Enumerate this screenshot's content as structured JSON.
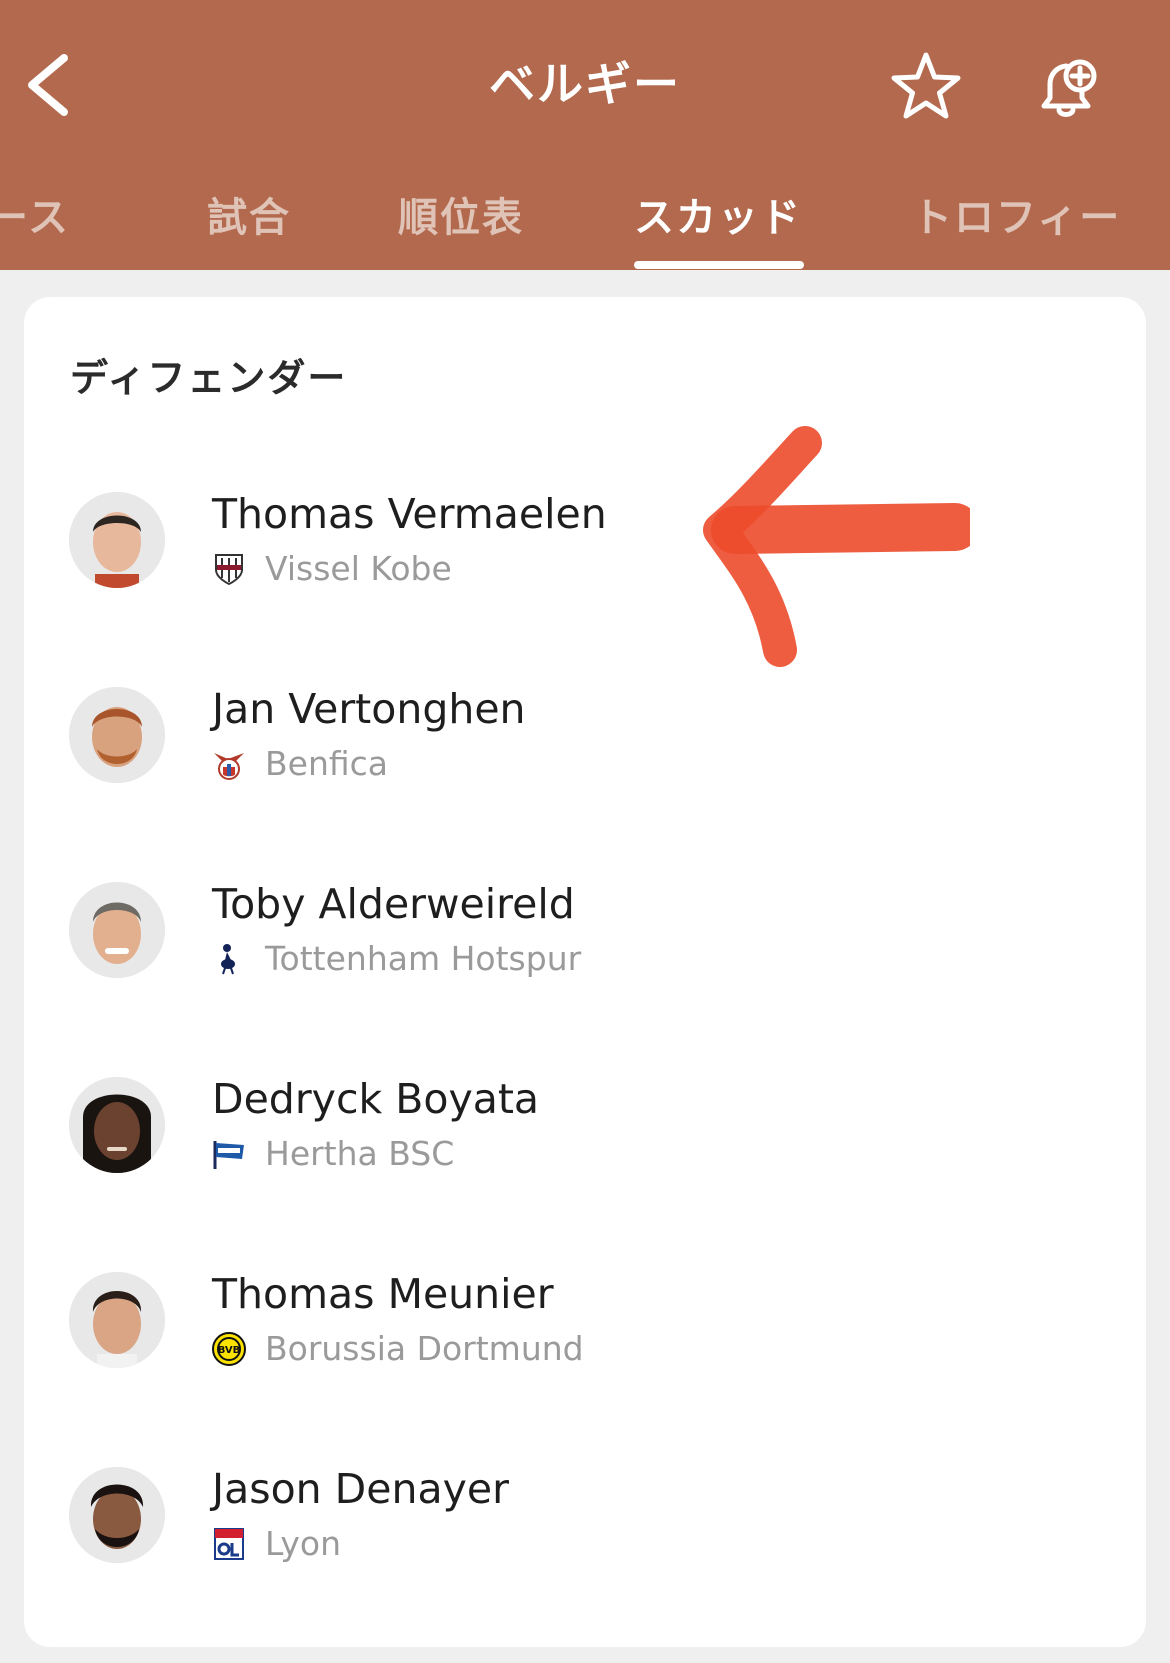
{
  "header": {
    "title": "ベルギー",
    "background_color": "#b2694d",
    "icons": {
      "back": "chevron-left-icon",
      "favorite": "star-icon",
      "notifications": "bell-plus-icon"
    }
  },
  "tabs": [
    {
      "label": "ース",
      "active": false
    },
    {
      "label": "試合",
      "active": false
    },
    {
      "label": "順位表",
      "active": false
    },
    {
      "label": "スカッド",
      "active": true
    },
    {
      "label": "トロフィー",
      "active": false
    }
  ],
  "section": {
    "title": "ディフェンダー",
    "players": [
      {
        "name": "Thomas Vermaelen",
        "club": "Vissel Kobe"
      },
      {
        "name": "Jan Vertonghen",
        "club": "Benfica"
      },
      {
        "name": "Toby Alderweireld",
        "club": "Tottenham Hotspur"
      },
      {
        "name": "Dedryck Boyata",
        "club": "Hertha BSC"
      },
      {
        "name": "Thomas Meunier",
        "club": "Borussia Dortmund"
      },
      {
        "name": "Jason Denayer",
        "club": "Lyon"
      }
    ]
  },
  "annotation": {
    "type": "hand-drawn-arrow",
    "color": "#ec4b2b"
  }
}
